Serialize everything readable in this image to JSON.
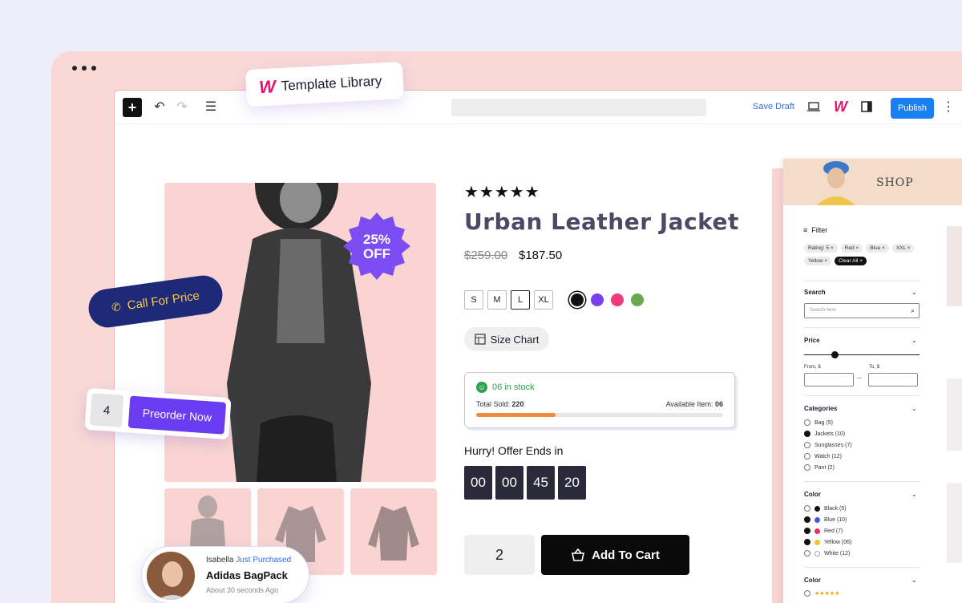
{
  "toolbar": {
    "save_draft": "Save Draft",
    "publish": "Publish",
    "template_library": "Template Library"
  },
  "product": {
    "rating_stars": "★★★★★",
    "title": "Urban Leather Jacket",
    "old_price": "$259.00",
    "new_price": "$187.50",
    "sizes": [
      "S",
      "M",
      "L",
      "XL"
    ],
    "selected_size": "L",
    "colors": [
      "#111111",
      "#7b3ff2",
      "#ef3b7c",
      "#6aa84f"
    ],
    "size_chart": "Size Chart",
    "discount_line1": "25%",
    "discount_line2": "OFF",
    "call_for_price": "Call For Price",
    "preorder_qty": "4",
    "preorder": "Preorder Now"
  },
  "stock": {
    "in_stock": "06 in stock",
    "total_sold_label": "Total Sold:",
    "total_sold": "220",
    "available_label": "Available Item:",
    "available": "06",
    "sold_fraction": 0.32
  },
  "offer": {
    "label": "Hurry! Offer Ends in",
    "timer": [
      "00",
      "00",
      "45",
      "20"
    ]
  },
  "cart": {
    "qty": "2",
    "add_to_cart": "Add To Cart"
  },
  "notification": {
    "name": "Isabella",
    "action": "Just Purchased",
    "product": "Adidas BagPack",
    "time": "About 30 seconds Ago"
  },
  "shop": {
    "banner": "SHOP",
    "filter": "Filter",
    "chips": [
      "Rating: 5",
      "Red",
      "Blue",
      "XXL",
      "Yellow"
    ],
    "clear_all": "Clear All",
    "search_title": "Search",
    "search_placeholder": "Search here",
    "price_title": "Price",
    "from_label": "From, $",
    "to_label": "To, $",
    "categories_title": "Categories",
    "categories": [
      "Bag  (5)",
      "Jackets  (10)",
      "Sunglasses  (7)",
      "Watch  (12)",
      "Pant  (2)"
    ],
    "color_title": "Color",
    "colors": [
      "Black  (5)",
      "Blue  (10)",
      "Red  (7)",
      "Yellow  (06)",
      "White  (12)"
    ],
    "color2_title": "Color",
    "color2_stars": "★★★★★"
  }
}
